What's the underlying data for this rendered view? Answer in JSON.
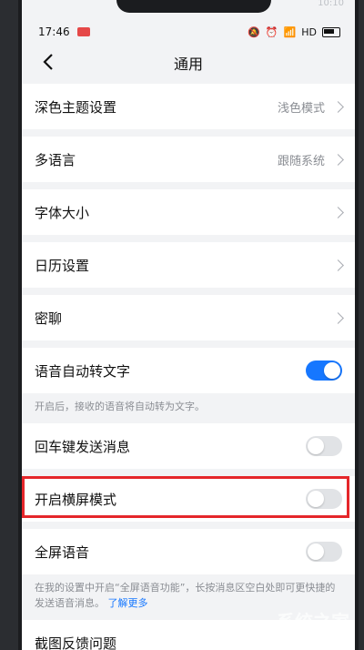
{
  "status": {
    "time": "17:46",
    "network": "HD",
    "ghost_time": "10:10"
  },
  "nav": {
    "title": "通用"
  },
  "rows": [
    {
      "label": "深色主题设置",
      "value": "浅色模式"
    },
    {
      "label": "多语言",
      "value": "跟随系统"
    },
    {
      "label": "字体大小",
      "value": ""
    },
    {
      "label": "日历设置",
      "value": ""
    },
    {
      "label": "密聊",
      "value": ""
    }
  ],
  "toggles": {
    "voice_to_text": {
      "label": "语音自动转文字",
      "hint": "开启后，接收的语音将自动转为文字。",
      "on": true
    },
    "enter_send": {
      "label": "回车键发送消息",
      "on": false
    },
    "landscape": {
      "label": "开启横屏模式",
      "on": false
    },
    "fullscreen_voice": {
      "label": "全屏语音",
      "hint": "在我的设置中开启“全屏语音功能”，长按消息区空白处即可更快捷的发送语音消息。",
      "link": "了解更多",
      "on": false
    }
  },
  "last_row": {
    "label": "截图反馈问题"
  },
  "watermark": {
    "big": "系统之家",
    "small": "XITONGZHIJIA.NET"
  },
  "colors": {
    "accent": "#1677ff",
    "highlight": "#e5262a"
  }
}
